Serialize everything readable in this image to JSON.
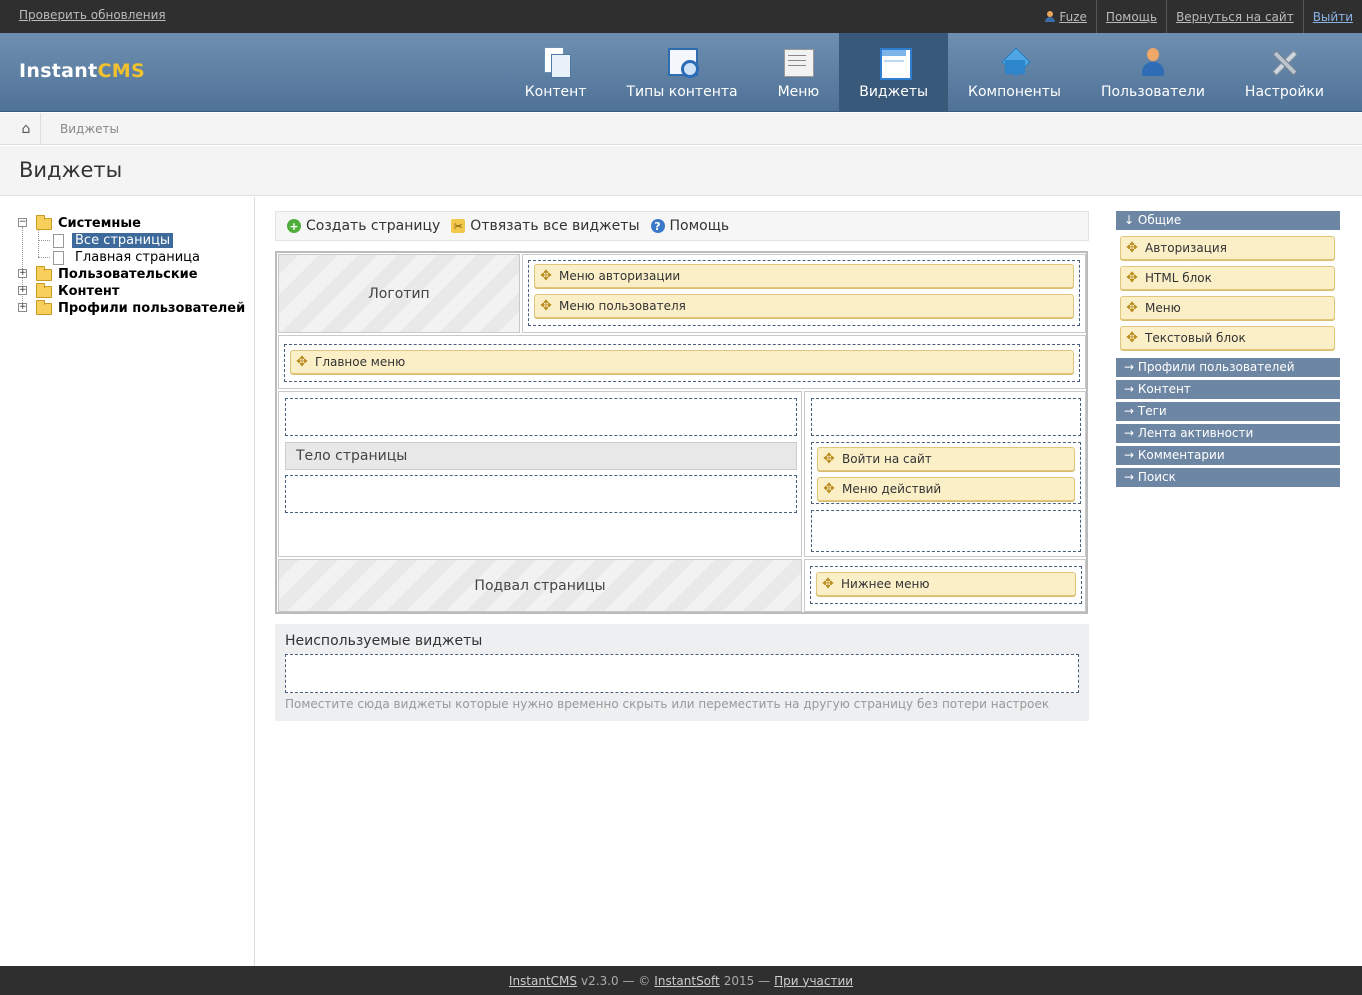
{
  "topbar": {
    "update_link": "Проверить обновления",
    "user": "Fuze",
    "help": "Помощь",
    "back_to_site": "Вернуться на сайт",
    "logout": "Выйти"
  },
  "header": {
    "logo_instant": "Instant",
    "logo_cms": "CMS",
    "nav": [
      {
        "label": "Контент",
        "icon": "content-icon"
      },
      {
        "label": "Типы контента",
        "icon": "content-types-icon"
      },
      {
        "label": "Меню",
        "icon": "menu-icon"
      },
      {
        "label": "Виджеты",
        "icon": "widgets-icon",
        "active": true
      },
      {
        "label": "Компоненты",
        "icon": "components-icon"
      },
      {
        "label": "Пользователи",
        "icon": "users-icon"
      },
      {
        "label": "Настройки",
        "icon": "settings-icon"
      }
    ]
  },
  "breadcrumb": {
    "current": "Виджеты"
  },
  "page_title": "Виджеты",
  "tree": {
    "nodes": [
      {
        "label": "Системные",
        "expanded": true
      },
      {
        "label": "Все страницы",
        "selected": true
      },
      {
        "label": "Главная страница"
      },
      {
        "label": "Пользовательские"
      },
      {
        "label": "Контент"
      },
      {
        "label": "Профили пользователей"
      }
    ]
  },
  "toolbar": {
    "create_page": "Создать страницу",
    "unbind_all": "Отвязать все виджеты",
    "help": "Помощь"
  },
  "layout": {
    "logo": "Логотип",
    "header_widgets": [
      "Меню авторизации",
      "Меню пользователя"
    ],
    "main_menu": "Главное меню",
    "page_body": "Тело страницы",
    "sidebar_widgets": [
      "Войти на сайт",
      "Меню действий"
    ],
    "footer": "Подвал страницы",
    "footer_widgets": [
      "Нижнее меню"
    ]
  },
  "unused": {
    "title": "Неиспользуемые виджеты",
    "hint": "Поместите сюда виджеты которые нужно временно скрыть или переместить на другую страницу без потери настроек"
  },
  "palette": {
    "groups": [
      {
        "label": "↓ Общие",
        "widgets": [
          "Авторизация",
          "HTML блок",
          "Меню",
          "Текстовый блок"
        ]
      },
      {
        "label": "→ Профили пользователей"
      },
      {
        "label": "→ Контент"
      },
      {
        "label": "→ Теги"
      },
      {
        "label": "→ Лента активности"
      },
      {
        "label": "→ Комментарии"
      },
      {
        "label": "→ Поиск"
      }
    ]
  },
  "footer": {
    "product": "InstantCMS",
    "version": "v2.3.0 — ©",
    "company": "InstantSoft",
    "year": "2015 —",
    "link": "При участии"
  },
  "colors": {
    "header_bg": "#5a7ca0",
    "active_nav": "#39597b",
    "widget_bg": "#fbefc8",
    "palette_head": "#6d86a3"
  }
}
